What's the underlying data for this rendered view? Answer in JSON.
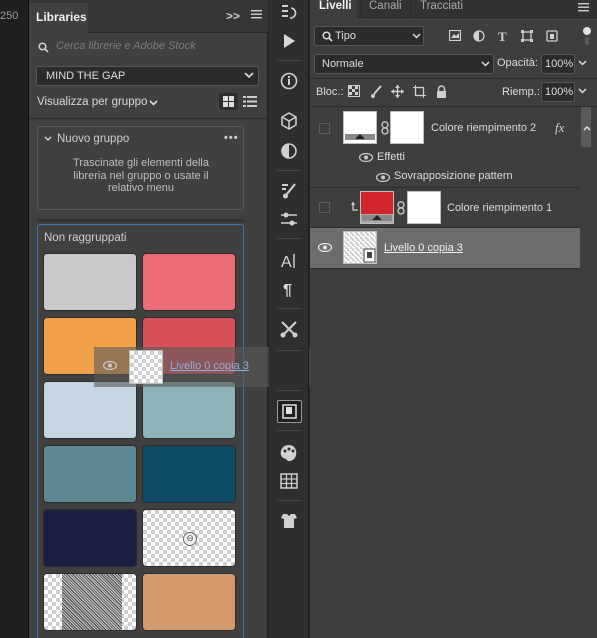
{
  "ruler": {
    "number": "250"
  },
  "libraries": {
    "tab_label": "Libraries",
    "collapse_label": ">>",
    "search_placeholder": "Cerca librerie e Adobe Stock",
    "library_name": "MIND THE GAP",
    "view_mode_label": "Visualizza per gruppo",
    "new_group": {
      "title": "Nuovo gruppo",
      "more": "•••",
      "hint": "Trascinate gli elementi della libreria nel gruppo o usate il relativo menu"
    },
    "ungrouped": {
      "title": "Non raggruppati",
      "swatches": [
        "#c9c9c9",
        "#ec6d78",
        "#f0a04a",
        "#d6515a",
        "#c4d6e4",
        "#8eb1ba",
        "#5f8793",
        "#0d4b67",
        "#1a1e42",
        "pattern",
        "texture",
        "#d4996c"
      ]
    }
  },
  "drag_ghost": {
    "label": "Livello 0 copia 3"
  },
  "layers": {
    "tabs": [
      "Livelli",
      "Canali",
      "Tracciati"
    ],
    "filter_label": "Tipo",
    "blend_mode": "Normale",
    "opacity_label": "Opacità:",
    "opacity_value": "100%",
    "lock_label": "Bloc.:",
    "fill_label": "Riemp.:",
    "fill_value": "100%",
    "rows": {
      "fill2": {
        "name": "Colore riempimento 2",
        "fx": "fx"
      },
      "effects": {
        "name": "Effetti"
      },
      "pattern_overlay": {
        "name": "Sovrapposizione pattern"
      },
      "fill1": {
        "name": "Colore riempimento 1",
        "color": "#d0262b"
      },
      "layer0copy3": {
        "name": "Livello 0 copia 3"
      }
    }
  },
  "colors": {
    "accent_blue": "#3e74b8",
    "selected_row": "#6d6d6d"
  }
}
